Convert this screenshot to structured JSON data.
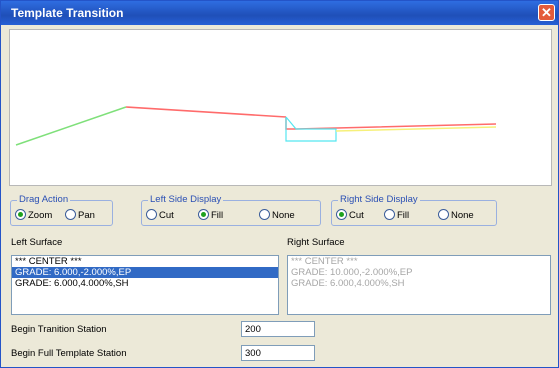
{
  "window": {
    "title": "Template Transition",
    "close_symbol": "✕"
  },
  "drag_action": {
    "legend": "Drag Action",
    "options": [
      {
        "label": "Zoom",
        "selected": true
      },
      {
        "label": "Pan",
        "selected": false
      }
    ]
  },
  "left_side_display": {
    "legend": "Left Side Display",
    "options": [
      {
        "label": "Cut",
        "selected": false
      },
      {
        "label": "Fill",
        "selected": true
      },
      {
        "label": "None",
        "selected": false
      }
    ]
  },
  "right_side_display": {
    "legend": "Right Side Display",
    "options": [
      {
        "label": "Cut",
        "selected": true
      },
      {
        "label": "Fill",
        "selected": false
      },
      {
        "label": "None",
        "selected": false
      }
    ]
  },
  "left_surface": {
    "label": "Left Surface",
    "items": [
      "*** CENTER ***",
      "GRADE: 6.000,-2.000%,EP",
      "GRADE: 6.000,4.000%,SH"
    ],
    "selected_index": 1
  },
  "right_surface": {
    "label": "Right Surface",
    "items": [
      "*** CENTER ***",
      "GRADE: 10.000,-2.000%,EP",
      "GRADE: 6.000,4.000%,SH"
    ]
  },
  "begin_transition_station": {
    "label": "Begin Tranition Station",
    "value": "200"
  },
  "begin_full_template_station": {
    "label": "Begin Full Template Station",
    "value": "300"
  },
  "colors": {
    "green_line": "#7fe07a",
    "red_line": "#ff6b6b",
    "cyan_line": "#55e6f0",
    "yellow_line": "#f6f07a",
    "selection": "#316ac5"
  }
}
